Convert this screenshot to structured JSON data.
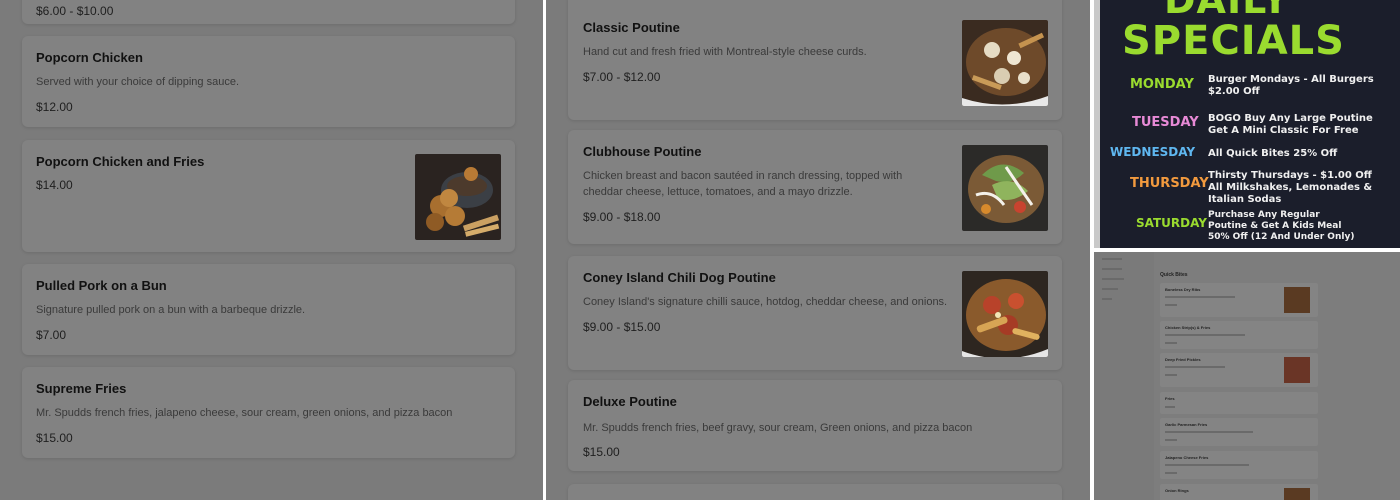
{
  "left_panel": {
    "top_price": "$6.00 - $10.00",
    "items": [
      {
        "title": "Popcorn Chicken",
        "desc": "Served with your choice of dipping sauce.",
        "price": "$12.00"
      },
      {
        "title": "Popcorn Chicken and Fries",
        "desc": "",
        "price": "$14.00"
      },
      {
        "title": "Pulled Pork on a Bun",
        "desc": "Signature pulled pork on a bun with a barbeque drizzle.",
        "price": "$7.00"
      },
      {
        "title": "Supreme Fries",
        "desc": "Mr. Spudds french fries, jalapeno cheese, sour cream, green onions, and pizza bacon",
        "price": "$15.00"
      }
    ]
  },
  "mid_panel": {
    "items": [
      {
        "title": "Classic Poutine",
        "desc": "Hand cut and fresh fried with Montreal-style cheese curds.",
        "price": "$7.00 - $12.00"
      },
      {
        "title": "Clubhouse Poutine",
        "desc1": "Chicken breast and bacon sautéed in ranch dressing, topped with",
        "desc2": "cheddar cheese, lettuce, tomatoes, and a mayo drizzle.",
        "price": "$9.00 - $18.00"
      },
      {
        "title": "Coney Island Chili Dog Poutine",
        "desc": "Coney Island's signature chilli sauce, hotdog, cheddar cheese, and onions.",
        "price": "$9.00 - $15.00"
      },
      {
        "title": "Deluxe Poutine",
        "desc": "Mr. Spudds french fries, beef gravy, sour cream, Green onions, and pizza bacon",
        "price": "$15.00"
      }
    ]
  },
  "poster": {
    "title1": "DAILY",
    "title2": "SPECIALS",
    "specials": [
      {
        "day": "MONDAY",
        "color": "#9adb2f",
        "line1": "Burger Mondays - All Burgers",
        "line2": "$2.00 Off",
        "line3": ""
      },
      {
        "day": "TUESDAY",
        "color": "#e78ad6",
        "line1": "BOGO Buy Any Large Poutine",
        "line2": "Get A Mini Classic For Free",
        "line3": ""
      },
      {
        "day": "WEDNESDAY",
        "color": "#5fb7f0",
        "line1": "All Quick Bites 25% Off",
        "line2": "",
        "line3": ""
      },
      {
        "day": "THURSDAY",
        "color": "#f29a3e",
        "line1": "Thirsty Thursdays - $1.00 Off",
        "line2": "All Milkshakes, Lemonades &",
        "line3": "Italian Sodas"
      },
      {
        "day": "SATURDAY",
        "color": "#9adb2f",
        "line1": "Purchase Any Regular",
        "line2": "Poutine & Get A Kids Meal",
        "line3": "50% Off (12 And Under Only)"
      }
    ]
  },
  "small_panel": {
    "section_title": "Quick Bites",
    "nav": [
      "",
      "",
      "",
      "",
      ""
    ],
    "cards": [
      {
        "title": "Boneless Dry Ribs",
        "has_thumb": true
      },
      {
        "title": "Chicken Strip(s) & Fries",
        "has_thumb": false
      },
      {
        "title": "Deep Fried Pickles",
        "has_thumb": true
      },
      {
        "title": "Fries",
        "has_thumb": false
      },
      {
        "title": "Garlic Parmesan Fries",
        "has_thumb": false
      },
      {
        "title": "Jalapeno Cheese Fries",
        "has_thumb": false
      },
      {
        "title": "Onion Rings",
        "has_thumb": true
      }
    ]
  }
}
